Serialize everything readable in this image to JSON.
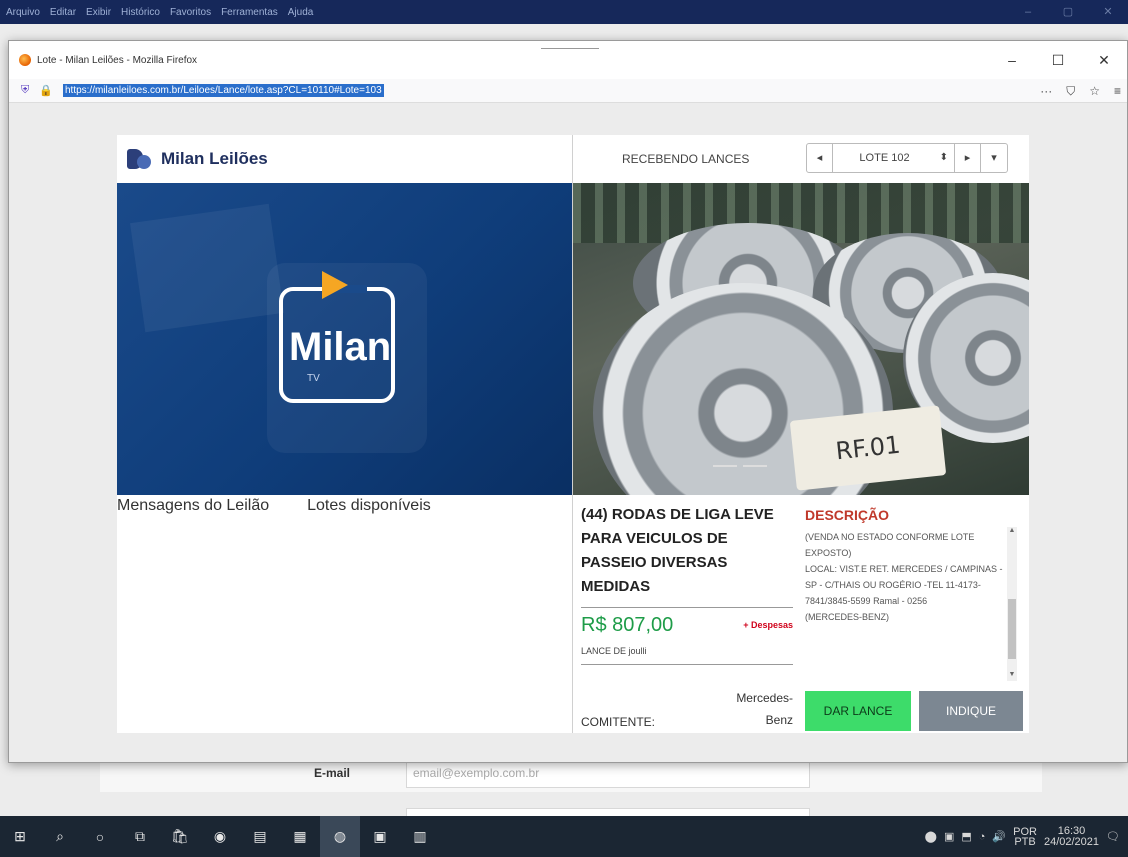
{
  "outer_window": {
    "menu": [
      "Arquivo",
      "Editar",
      "Exibir",
      "Histórico",
      "Favoritos",
      "Ferramentas",
      "Ajuda"
    ],
    "controls": [
      "–",
      "▢",
      "✕"
    ]
  },
  "popup": {
    "title": "Lote - Milan Leilões - Mozilla Firefox",
    "url": "https://milanleiloes.com.br/Leiloes/Lance/lote.asp?CL=10110#Lote=103",
    "controls": {
      "minimize": "–",
      "maximize": "☐",
      "close": "✕"
    },
    "toolbar_icons": {
      "more": "···",
      "pocket": "⛉",
      "bookmark": "☆",
      "menu": "≡"
    }
  },
  "brand": {
    "name": "Milan Leilões"
  },
  "video": {
    "title": "Milan",
    "subtitle": "TV"
  },
  "status": {
    "text": "RECEBENDO LANCES"
  },
  "lot_nav": {
    "prev": "◂",
    "selected": "LOTE 102",
    "arrows": "⬍",
    "next": "▸",
    "more": "▾"
  },
  "photo": {
    "tag_text": "RF.01"
  },
  "tabs": [
    "Mensagens do Leilão",
    "Lotes disponíveis"
  ],
  "lot": {
    "title": "(44) RODAS DE LIGA LEVE PARA VEICULOS DE PASSEIO DIVERSAS MEDIDAS",
    "price": "R$ 807,00",
    "despesas": "+ Despesas",
    "lance_de": "LANCE DE joulli",
    "comitente_label": "COMITENTE:",
    "comitente_value": "Mercedes-Benz"
  },
  "description": {
    "title": "DESCRIÇÃO",
    "lines": [
      "(VENDA NO ESTADO CONFORME LOTE EXPOSTO)",
      "LOCAL: VIST.E RET. MERCEDES / CAMPINAS - SP - C/THAIS OU ROGÉRIO -TEL 11-4173-7841/3845-5599 Ramal - 0256",
      "(MERCEDES-BENZ)"
    ],
    "btn_lance": "DAR LANCE",
    "btn_indique": "INDIQUE"
  },
  "background_form": {
    "email_label": "E-mail",
    "email_placeholder": "email@exemplo.com.br"
  },
  "taskbar": {
    "icons": [
      "⊞",
      "⌕",
      "○",
      "⧉",
      "🛍",
      "◉",
      "▤",
      "▦",
      "◍",
      "▣",
      "▥"
    ],
    "tray": {
      "lang_top": "POR",
      "lang_bottom": "PTB",
      "time": "16:30",
      "date": "24/02/2021"
    }
  }
}
